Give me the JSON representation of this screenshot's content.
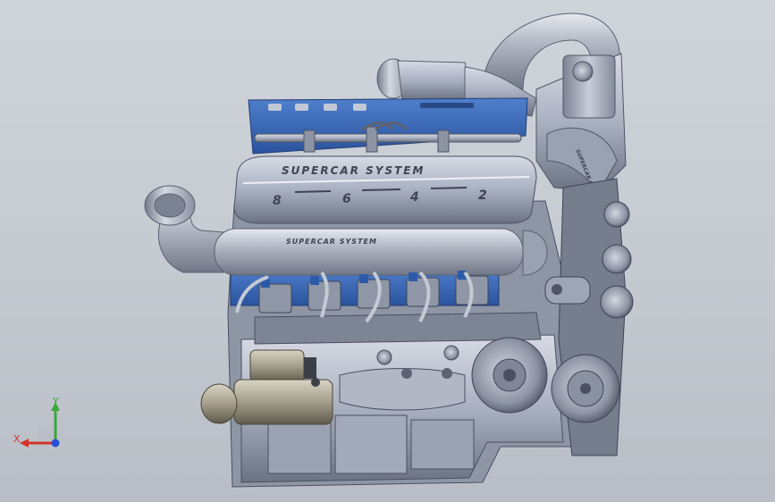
{
  "viewport": {
    "background_top": "#cfd3da",
    "background_bottom": "#b9bec6"
  },
  "model": {
    "valve_cover_text": "SUPERCAR SYSTEM",
    "intake_tube_text": "SUPERCAR SYSTEM",
    "supercharger_text": "SUPERCAR SYSTEM",
    "cylinder_numbers": [
      "8",
      "6",
      "4",
      "2"
    ],
    "colors": {
      "metal": "#a9b0c0",
      "metal_light": "#c9ceda",
      "metal_dark": "#6b7282",
      "accent_blue": "#3a6bb8",
      "coil_blue": "#2d5aa8"
    }
  },
  "triad": {
    "x_label": "X",
    "y_label": "Y",
    "x_color": "#d2342b",
    "y_color": "#3aa83a",
    "z_color": "#2b4fd2"
  }
}
